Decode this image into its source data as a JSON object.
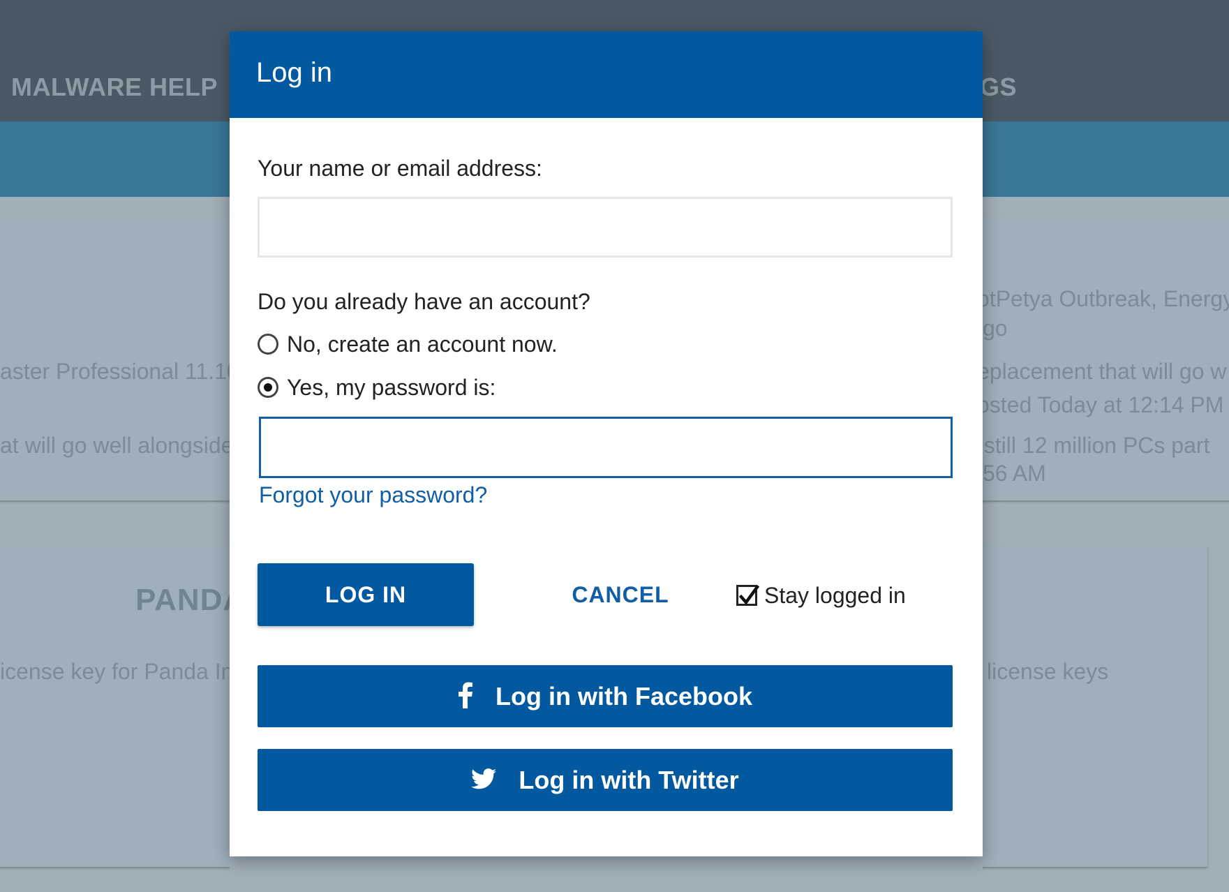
{
  "background": {
    "nav": {
      "malware_help": "MALWARE HELP",
      "right_fragment": "GS"
    },
    "left_card": {
      "line1": "aster Professional 11.10",
      "line2": "at will go well alongside"
    },
    "right_card": {
      "line1": "otPetya Outbreak, Energy",
      "line2": "go",
      "line3": "eplacement that will go w",
      "line4": "osted Today at 12:14 PM",
      "line5": ", still 12 million PCs part",
      "line6": "56 AM"
    },
    "lower_card": {
      "heading": "PANDA",
      "left_text": "icense key for Panda In",
      "right_text": "license keys"
    }
  },
  "modal": {
    "title": "Log in",
    "name_label": "Your name or email address:",
    "name_value": "",
    "account_question": "Do you already have an account?",
    "radio_no": "No, create an account now.",
    "radio_yes": "Yes, my password is:",
    "selected_option": "yes",
    "password_value": "",
    "forgot_link": "Forgot your password?",
    "login_button": "LOG IN",
    "cancel_button": "CANCEL",
    "stay_logged_in_label": "Stay logged in",
    "stay_logged_in_checked": true,
    "facebook_button": "Log in with Facebook",
    "twitter_button": "Log in with Twitter"
  },
  "colors": {
    "accent": "#03599f",
    "link": "#0f5ea6",
    "nav_bg": "#4a5a65",
    "band_bg": "#3a7797"
  }
}
